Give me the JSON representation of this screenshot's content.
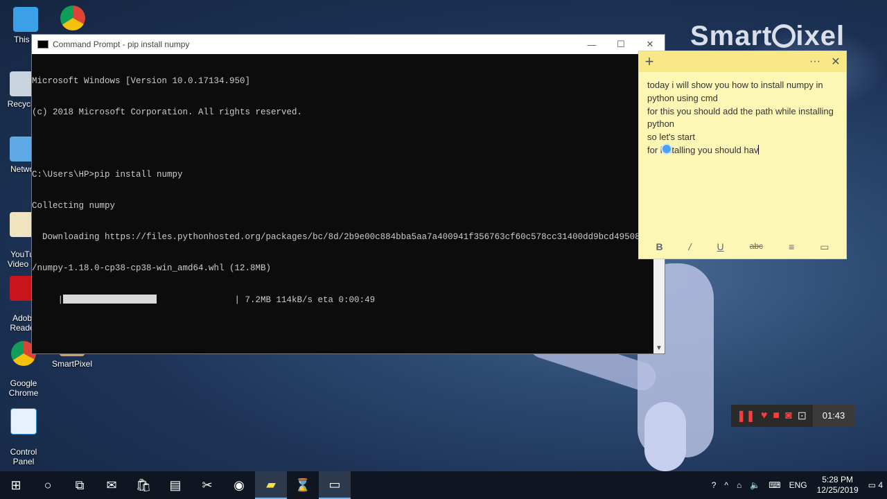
{
  "desktop": {
    "icons": [
      {
        "label": "This P"
      },
      {
        "label": "Recycle"
      },
      {
        "label": "Netwo"
      },
      {
        "label": "YouTu\nVideo D"
      },
      {
        "label": "Adob\nReade"
      },
      {
        "label": "Google\nChrome"
      },
      {
        "label": "SmartPixel"
      },
      {
        "label": "Control\nPanel"
      }
    ],
    "brand": "SmartPixel"
  },
  "cmd": {
    "title": "Command Prompt - pip  install numpy",
    "lines": [
      "Microsoft Windows [Version 10.0.17134.950]",
      "(c) 2018 Microsoft Corporation. All rights reserved.",
      "",
      "C:\\Users\\HP>pip install numpy",
      "Collecting numpy",
      "  Downloading https://files.pythonhosted.org/packages/bc/8d/2b9e00c884bba5aa7a400941f356763cf60c578cc31400dd9bcd49508",
      "/numpy-1.18.0-cp38-cp38-win_amd64.whl (12.8MB)"
    ],
    "progress_bar_prefix": "     |",
    "progress_bar_suffix": "               | 7.2MB 114kB/s eta 0:00:49",
    "progress_fraction": 0.56
  },
  "note": {
    "lines": [
      "today i will show you how to install numpy in python using cmd",
      "for this you should add the path while installing python",
      "so let's start",
      "for installing you should hav"
    ],
    "tools": [
      "B",
      "/",
      "U",
      "abc",
      "≡",
      "▭"
    ]
  },
  "recorder": {
    "time": "01:43"
  },
  "taskbar": {
    "lang": "ENG",
    "time": "5:28 PM",
    "date": "12/25/2019",
    "notifications": "4"
  }
}
